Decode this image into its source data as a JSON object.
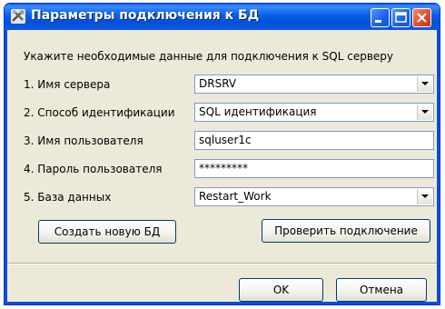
{
  "window": {
    "title": "Параметры подключения к БД",
    "controls": [
      "minimize-icon",
      "maximize-icon",
      "close-icon"
    ]
  },
  "instruction": "Укажите необходимые данные для подключения к SQL  серверу",
  "fields": {
    "server": {
      "label": "1. Имя сервера",
      "value": "DRSRV"
    },
    "auth": {
      "label": "2. Способ идентификации",
      "value": "SQL идентификация"
    },
    "user": {
      "label": "3. Имя пользователя",
      "value": "sqluser1c"
    },
    "password": {
      "label": "4. Пароль пользователя",
      "value": "*********"
    },
    "database": {
      "label": "5. База данных",
      "value": "Restart_Work"
    }
  },
  "buttons": {
    "create_db": "Создать новую БД",
    "test_connection": "Проверить подключение",
    "ok": "OK",
    "cancel": "Отмена"
  },
  "colors": {
    "titlebar": "#0a5ee8",
    "dialog_bg": "#ece9d8",
    "close_button": "#e04a24"
  }
}
